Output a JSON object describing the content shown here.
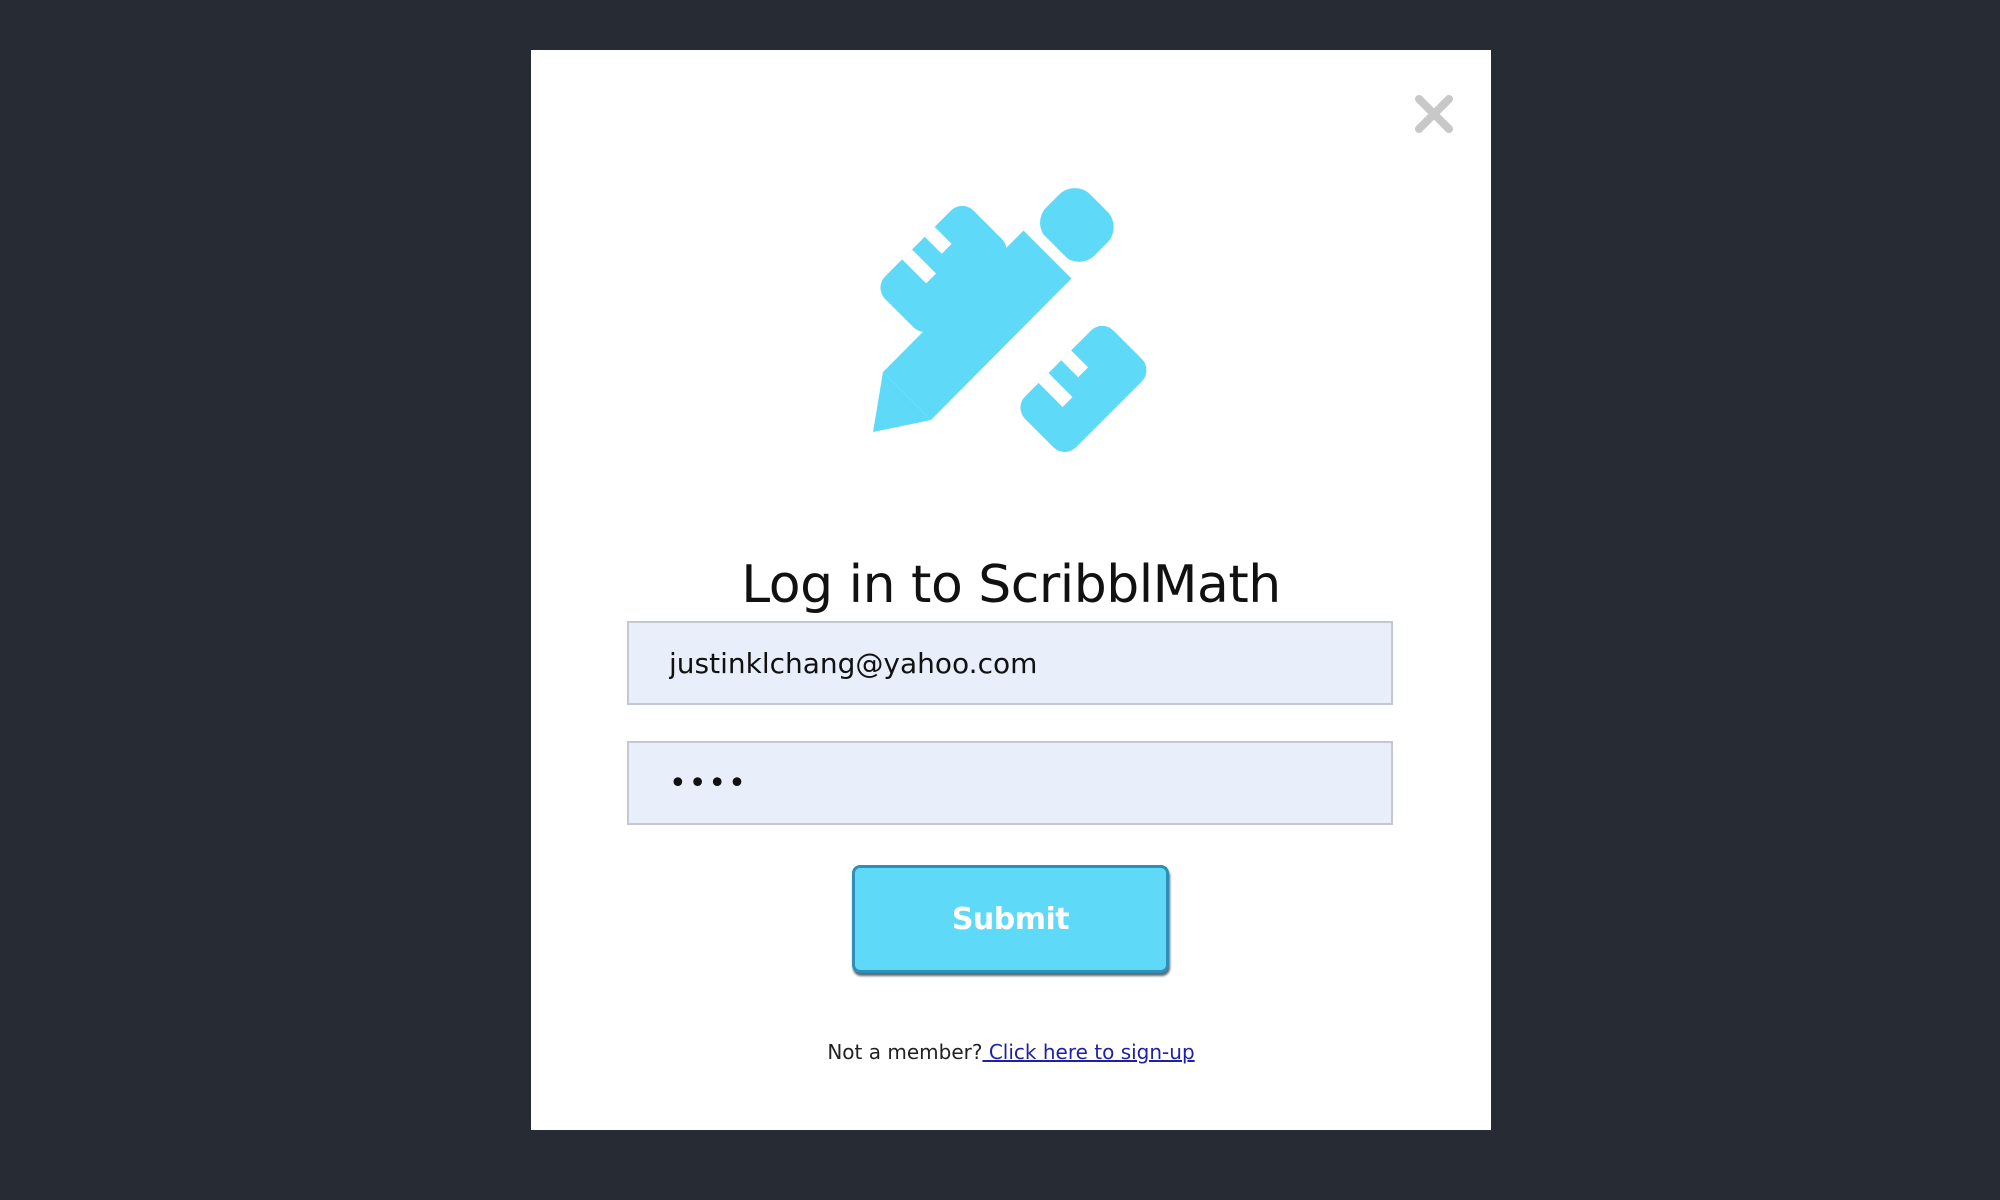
{
  "modal": {
    "title": "Log in to ScribblMath",
    "logo_icon": "pencil-ruler-icon",
    "close_icon": "close-icon",
    "accent_color": "#5fd9f8",
    "background_color": "#272b34"
  },
  "form": {
    "email_value": "justinklchang@yahoo.com",
    "password_value": "••••",
    "submit_label": "Submit"
  },
  "signup": {
    "prompt": "Not a member?",
    "link_label": " Click here to sign-up"
  }
}
